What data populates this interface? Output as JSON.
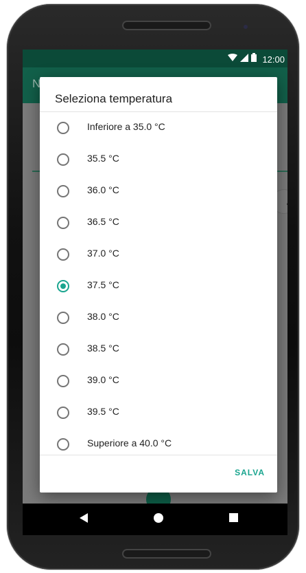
{
  "status_bar": {
    "time": "12:00"
  },
  "app_bar": {
    "title_fragment": "N"
  },
  "dialog": {
    "title": "Seleziona temperatura",
    "options": [
      {
        "label": "Inferiore a 35.0 °C",
        "selected": false
      },
      {
        "label": "35.5 °C",
        "selected": false
      },
      {
        "label": "36.0 °C",
        "selected": false
      },
      {
        "label": "36.5 °C",
        "selected": false
      },
      {
        "label": "37.0 °C",
        "selected": false
      },
      {
        "label": "37.5 °C",
        "selected": true
      },
      {
        "label": "38.0 °C",
        "selected": false
      },
      {
        "label": "38.5 °C",
        "selected": false
      },
      {
        "label": "39.0 °C",
        "selected": false
      },
      {
        "label": "39.5 °C",
        "selected": false
      },
      {
        "label": "Superiore a 40.0 °C",
        "selected": false
      }
    ],
    "save_label": "SALVA"
  },
  "icons": {
    "wifi": "wifi-icon",
    "signal": "signal-icon",
    "battery": "battery-icon",
    "back": "back-icon",
    "home": "home-icon",
    "recents": "recents-icon",
    "edit": "edit-icon"
  },
  "colors": {
    "status_bar": "#0b4a38",
    "app_bar": "#12604a",
    "accent": "#1aa58f"
  }
}
